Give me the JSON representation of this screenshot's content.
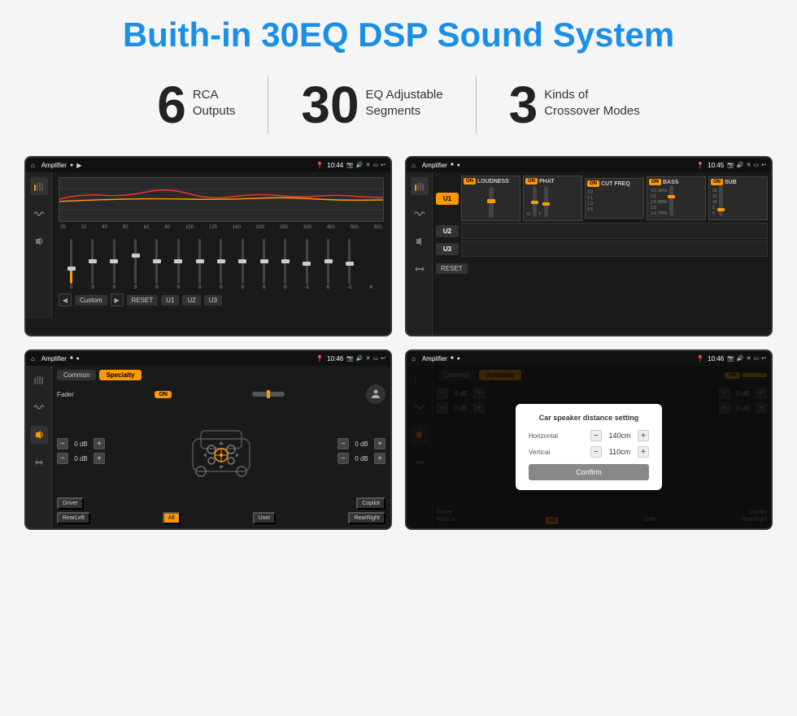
{
  "header": {
    "title": "Buith-in 30EQ DSP Sound System"
  },
  "stats": [
    {
      "number": "6",
      "line1": "RCA",
      "line2": "Outputs"
    },
    {
      "number": "30",
      "line1": "EQ Adjustable",
      "line2": "Segments"
    },
    {
      "number": "3",
      "line1": "Kinds of",
      "line2": "Crossover Modes"
    }
  ],
  "screens": {
    "eq": {
      "title": "Amplifier",
      "time": "10:44",
      "freq_labels": [
        "25",
        "32",
        "40",
        "50",
        "63",
        "80",
        "100",
        "125",
        "160",
        "200",
        "250",
        "320",
        "400",
        "500",
        "630"
      ],
      "slider_values": [
        "0",
        "0",
        "0",
        "5",
        "0",
        "0",
        "0",
        "0",
        "0",
        "0",
        "0",
        "-1",
        "0",
        "-1"
      ],
      "buttons": [
        "Custom",
        "RESET",
        "U1",
        "U2",
        "U3"
      ]
    },
    "crossover": {
      "title": "Amplifier",
      "time": "10:45",
      "presets": [
        "U1",
        "U2",
        "U3"
      ],
      "panels": [
        {
          "on": true,
          "label": "LOUDNESS"
        },
        {
          "on": true,
          "label": "PHAT"
        },
        {
          "on": true,
          "label": "CUT FREQ"
        },
        {
          "on": true,
          "label": "BASS"
        },
        {
          "on": true,
          "label": "SUB"
        }
      ],
      "reset": "RESET"
    },
    "fader": {
      "title": "Amplifier",
      "time": "10:46",
      "tabs": [
        "Common",
        "Specialty"
      ],
      "fader_label": "Fader",
      "db_values": [
        "0 dB",
        "0 dB",
        "0 dB",
        "0 dB"
      ],
      "bottom_btns": [
        "Driver",
        "Copilot",
        "RearLeft",
        "All",
        "User",
        "RearRight"
      ]
    },
    "dialog": {
      "title": "Amplifier",
      "time": "10:46",
      "tabs": [
        "Common",
        "Specialty"
      ],
      "dialog_title": "Car speaker distance setting",
      "horizontal_label": "Horizontal",
      "horizontal_value": "140cm",
      "vertical_label": "Vertical",
      "vertical_value": "110cm",
      "confirm_label": "Confirm",
      "db_values": [
        "0 dB",
        "0 dB"
      ],
      "bottom_btns": [
        "Driver",
        "Copilot",
        "RearLeft",
        "All",
        "User",
        "RearRight"
      ]
    }
  },
  "icons": {
    "home": "⌂",
    "settings": "⚙",
    "wifi": "≋",
    "sound": "♪",
    "back": "↩",
    "camera": "📷",
    "speaker": "🔊",
    "cross": "✕",
    "rect": "▭",
    "arrow_left": "◀",
    "arrow_right": "▶",
    "more": "»"
  },
  "colors": {
    "accent": "#f90",
    "blue": "#1a8fe8",
    "bg_dark": "#1a1a1a",
    "bg_medium": "#2a2a2a",
    "text_light": "#ccc"
  }
}
